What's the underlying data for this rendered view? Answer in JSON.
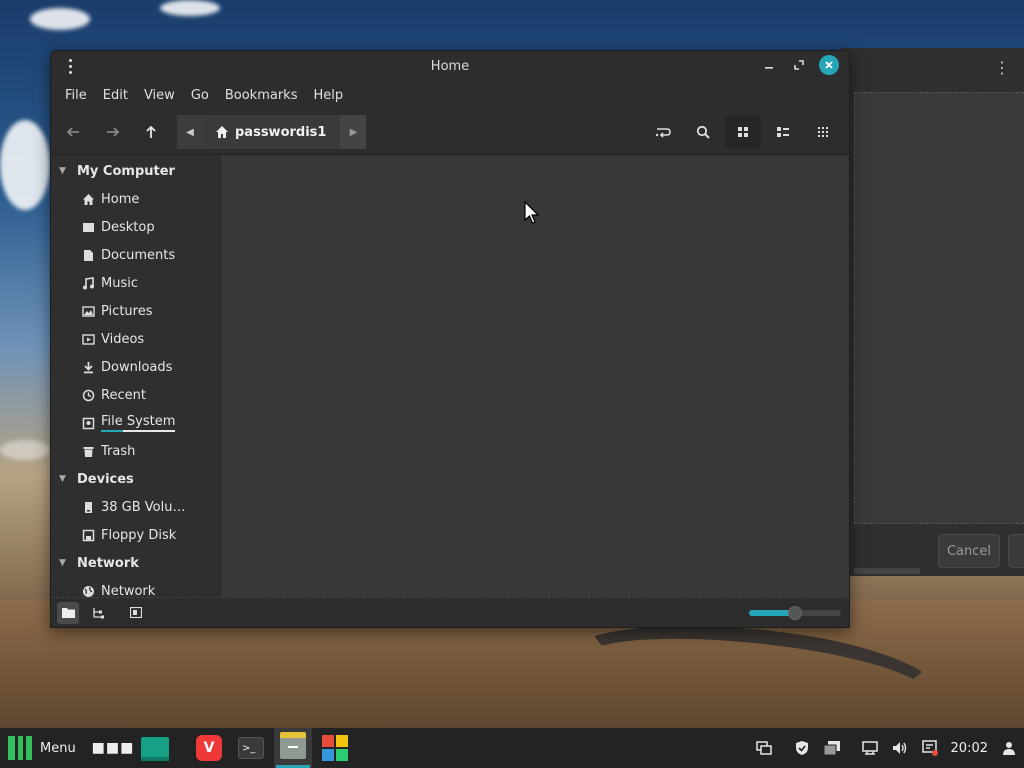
{
  "window": {
    "title": "Home"
  },
  "menubar": {
    "items": [
      "File",
      "Edit",
      "View",
      "Go",
      "Bookmarks",
      "Help"
    ]
  },
  "toolbar": {
    "path_crumb": "passwordis1"
  },
  "sidebar": {
    "sections": [
      {
        "header": "My Computer",
        "items": [
          {
            "label": "Home",
            "icon": "home-icon"
          },
          {
            "label": "Desktop",
            "icon": "desktop-icon"
          },
          {
            "label": "Documents",
            "icon": "documents-icon"
          },
          {
            "label": "Music",
            "icon": "music-icon"
          },
          {
            "label": "Pictures",
            "icon": "pictures-icon"
          },
          {
            "label": "Videos",
            "icon": "videos-icon"
          },
          {
            "label": "Downloads",
            "icon": "downloads-icon"
          },
          {
            "label": "Recent",
            "icon": "recent-icon"
          },
          {
            "label": "File System",
            "icon": "filesystem-icon"
          },
          {
            "label": "Trash",
            "icon": "trash-icon"
          }
        ]
      },
      {
        "header": "Devices",
        "items": [
          {
            "label": "38 GB Volu…",
            "icon": "drive-icon"
          },
          {
            "label": "Floppy Disk",
            "icon": "floppy-icon"
          }
        ]
      },
      {
        "header": "Network",
        "items": [
          {
            "label": "Network",
            "icon": "network-icon"
          }
        ]
      }
    ]
  },
  "statusbar": {
    "zoom_fraction": 0.5
  },
  "background_dialog": {
    "cancel_label": "Cancel"
  },
  "taskbar": {
    "menu_label": "Menu",
    "clock": "20:02"
  },
  "colors": {
    "accent": "#26a5b8",
    "manjaro_green": "#35bf5c",
    "vivaldi_red": "#ef3939"
  }
}
